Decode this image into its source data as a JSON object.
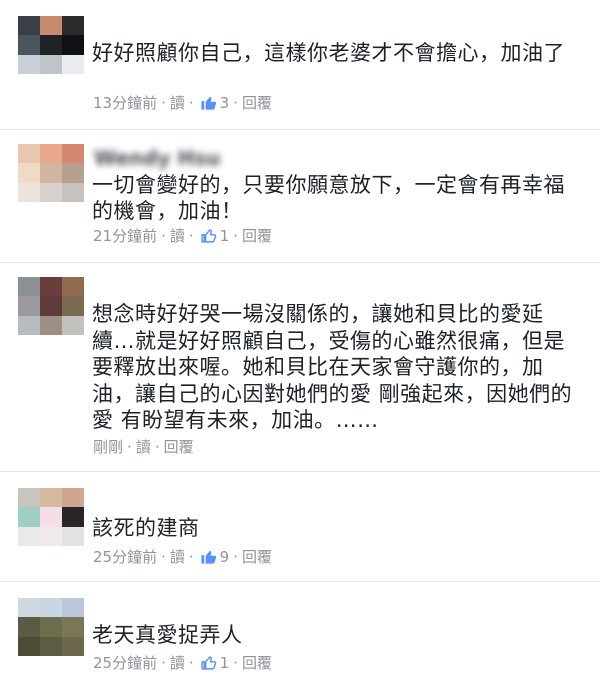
{
  "comments": [
    {
      "text": "好好照顧你自己，這樣你老婆才不會擔心，加油了",
      "time": "13分鐘前",
      "read_label": "讀",
      "likes": "3",
      "reply_label": "回覆",
      "avatar_colors": [
        "#3a3f46",
        "#c88a6d",
        "#2b2b2b",
        "#4a5560",
        "#1f2226",
        "#0f1114",
        "#c9cfd6",
        "#bfc4cb",
        "#e9ecef"
      ]
    },
    {
      "name": "Wendy Hsu",
      "text": "一切會變好的，只要你願意放下，一定會有再幸福的機會，加油！",
      "time": "21分鐘前",
      "read_label": "讀",
      "likes": "1",
      "reply_label": "回覆",
      "avatar_colors": [
        "#e9c6b0",
        "#e8a88b",
        "#d6876f",
        "#f1d9c7",
        "#d2b4a0",
        "#b7a092",
        "#ece3da",
        "#d6d3cf",
        "#c6c2be"
      ]
    },
    {
      "text": "想念時好好哭一場沒關係的，讓她和貝比的愛延續…就是好好照顧自己，受傷的心雖然很痛，但是要釋放出來喔。她和貝比在天家會守護你的，加油，讓自己的心因對她們的愛 剛強起來，因她們的愛 有盼望有未來，加油。……",
      "time": "剛剛",
      "read_label": "讀",
      "reply_label": "回覆",
      "avatar_colors": [
        "#8b8f96",
        "#6b3d3a",
        "#8f6a4f",
        "#9a9aa0",
        "#5e3a3b",
        "#7a6a52",
        "#b8bcc2",
        "#9d8f86",
        "#c3c1bd"
      ]
    },
    {
      "text": "該死的建商",
      "time": "25分鐘前",
      "read_label": "讀",
      "likes": "9",
      "reply_label": "回覆",
      "avatar_colors": [
        "#c9c4bf",
        "#d7b9a0",
        "#cfa68f",
        "#9fcfc2",
        "#f4dfe6",
        "#2a2426",
        "#e7e9eb",
        "#efe9ec",
        "#e3e1e2"
      ]
    },
    {
      "text": "老天真愛捉弄人",
      "time": "25分鐘前",
      "read_label": "讀",
      "likes": "1",
      "reply_label": "回覆",
      "avatar_colors": [
        "#cfd8e0",
        "#c9d6e6",
        "#b8c8d8",
        "#5a5a45",
        "#6d6e4e",
        "#7a7757",
        "#4c4b38",
        "#5e5b44",
        "#6b684e"
      ]
    }
  ]
}
